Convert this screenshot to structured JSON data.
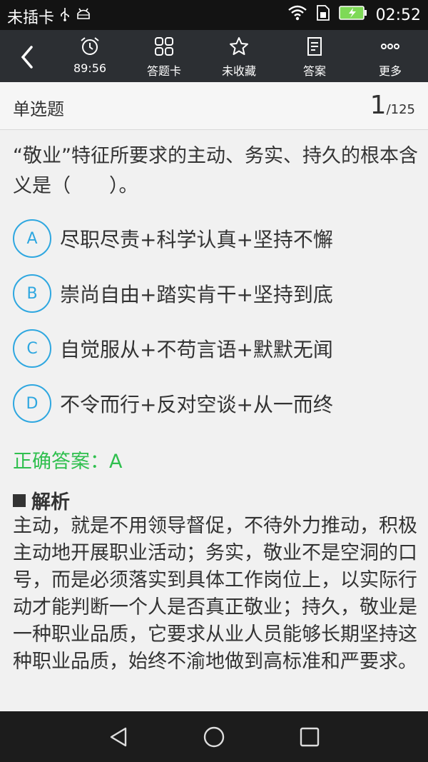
{
  "status_bar": {
    "carrier": "未插卡",
    "time": "02:52"
  },
  "toolbar": {
    "items": [
      {
        "label": "89:56",
        "icon": "alarm-clock-icon"
      },
      {
        "label": "答题卡",
        "icon": "grid-icon"
      },
      {
        "label": "未收藏",
        "icon": "star-icon"
      },
      {
        "label": "答案",
        "icon": "document-icon"
      },
      {
        "label": "更多",
        "icon": "more-dots-icon"
      }
    ]
  },
  "question": {
    "type": "单选题",
    "current": "1",
    "total": "/125",
    "stem": "“敬业”特征所要求的主动、务实、持久的根本含义是（　　）。",
    "options": [
      {
        "letter": "A",
        "text": "尽职尽责+科学认真+坚持不懈"
      },
      {
        "letter": "B",
        "text": "崇尚自由+踏实肯干+坚持到底"
      },
      {
        "letter": "C",
        "text": "自觉服从+不苟言语+默默无闻"
      },
      {
        "letter": "D",
        "text": "不令而行+反对空谈+从一而终"
      }
    ],
    "correct_answer": "正确答案：A",
    "analysis_title": "解析",
    "analysis_text": "主动，就是不用领导督促，不待外力推动，积极主动地开展职业活动；务实，敬业不是空洞的口号，而是必须落实到具体工作岗位上，以实际行动才能判断一个人是否真正敬业；持久，敬业是一种职业品质，它要求从业人员能够长期坚持这种职业品质，始终不渝地做到高标准和严要求。"
  },
  "colors": {
    "toolbar_bg": "#2c2f33",
    "accent_blue": "#2ea7e0",
    "answer_green": "#2fbf4e"
  }
}
